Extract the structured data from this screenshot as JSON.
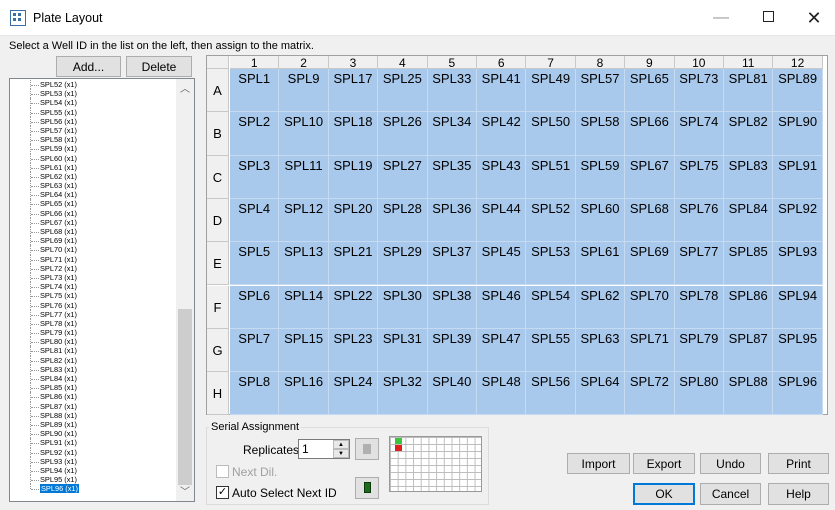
{
  "window": {
    "title": "Plate Layout"
  },
  "instruction": "Select a Well ID in the list on the left, then assign to the matrix.",
  "buttons": {
    "add": "Add...",
    "delete": "Delete",
    "import": "Import",
    "export": "Export",
    "undo": "Undo",
    "print": "Print",
    "ok": "OK",
    "cancel": "Cancel",
    "help": "Help"
  },
  "list": {
    "items": [
      "SPL52 (x1)",
      "SPL53 (x1)",
      "SPL54 (x1)",
      "SPL55 (x1)",
      "SPL56 (x1)",
      "SPL57 (x1)",
      "SPL58 (x1)",
      "SPL59 (x1)",
      "SPL60 (x1)",
      "SPL61 (x1)",
      "SPL62 (x1)",
      "SPL63 (x1)",
      "SPL64 (x1)",
      "SPL65 (x1)",
      "SPL66 (x1)",
      "SPL67 (x1)",
      "SPL68 (x1)",
      "SPL69 (x1)",
      "SPL70 (x1)",
      "SPL71 (x1)",
      "SPL72 (x1)",
      "SPL73 (x1)",
      "SPL74 (x1)",
      "SPL75 (x1)",
      "SPL76 (x1)",
      "SPL77 (x1)",
      "SPL78 (x1)",
      "SPL79 (x1)",
      "SPL80 (x1)",
      "SPL81 (x1)",
      "SPL82 (x1)",
      "SPL83 (x1)",
      "SPL84 (x1)",
      "SPL85 (x1)",
      "SPL86 (x1)",
      "SPL87 (x1)",
      "SPL88 (x1)",
      "SPL89 (x1)",
      "SPL90 (x1)",
      "SPL91 (x1)",
      "SPL92 (x1)",
      "SPL93 (x1)",
      "SPL94 (x1)",
      "SPL95 (x1)",
      "SPL96 (x1)"
    ],
    "selected": "SPL96 (x1)"
  },
  "plate": {
    "columns": [
      "1",
      "2",
      "3",
      "4",
      "5",
      "6",
      "7",
      "8",
      "9",
      "10",
      "11",
      "12"
    ],
    "rows": [
      "A",
      "B",
      "C",
      "D",
      "E",
      "F",
      "G",
      "H"
    ],
    "wells": [
      [
        "SPL1",
        "SPL9",
        "SPL17",
        "SPL25",
        "SPL33",
        "SPL41",
        "SPL49",
        "SPL57",
        "SPL65",
        "SPL73",
        "SPL81",
        "SPL89"
      ],
      [
        "SPL2",
        "SPL10",
        "SPL18",
        "SPL26",
        "SPL34",
        "SPL42",
        "SPL50",
        "SPL58",
        "SPL66",
        "SPL74",
        "SPL82",
        "SPL90"
      ],
      [
        "SPL3",
        "SPL11",
        "SPL19",
        "SPL27",
        "SPL35",
        "SPL43",
        "SPL51",
        "SPL59",
        "SPL67",
        "SPL75",
        "SPL83",
        "SPL91"
      ],
      [
        "SPL4",
        "SPL12",
        "SPL20",
        "SPL28",
        "SPL36",
        "SPL44",
        "SPL52",
        "SPL60",
        "SPL68",
        "SPL76",
        "SPL84",
        "SPL92"
      ],
      [
        "SPL5",
        "SPL13",
        "SPL21",
        "SPL29",
        "SPL37",
        "SPL45",
        "SPL53",
        "SPL61",
        "SPL69",
        "SPL77",
        "SPL85",
        "SPL93"
      ],
      [
        "SPL6",
        "SPL14",
        "SPL22",
        "SPL30",
        "SPL38",
        "SPL46",
        "SPL54",
        "SPL62",
        "SPL70",
        "SPL78",
        "SPL86",
        "SPL94"
      ],
      [
        "SPL7",
        "SPL15",
        "SPL23",
        "SPL31",
        "SPL39",
        "SPL47",
        "SPL55",
        "SPL63",
        "SPL71",
        "SPL79",
        "SPL87",
        "SPL95"
      ],
      [
        "SPL8",
        "SPL16",
        "SPL24",
        "SPL32",
        "SPL40",
        "SPL48",
        "SPL56",
        "SPL64",
        "SPL72",
        "SPL80",
        "SPL88",
        "SPL96"
      ]
    ],
    "well_color": "#a9c9ec"
  },
  "serial": {
    "legend": "Serial Assignment",
    "replicates_label": "Replicates:",
    "replicates_value": "1",
    "next_dil_label": "Next Dil.",
    "next_dil_checked": false,
    "auto_select_label": "Auto Select Next ID",
    "auto_select_checked": true
  },
  "colors": {
    "accent": "#0078d7",
    "selection": "#0078d7",
    "mini_green": "#3ec33e",
    "mini_red": "#e02020"
  }
}
